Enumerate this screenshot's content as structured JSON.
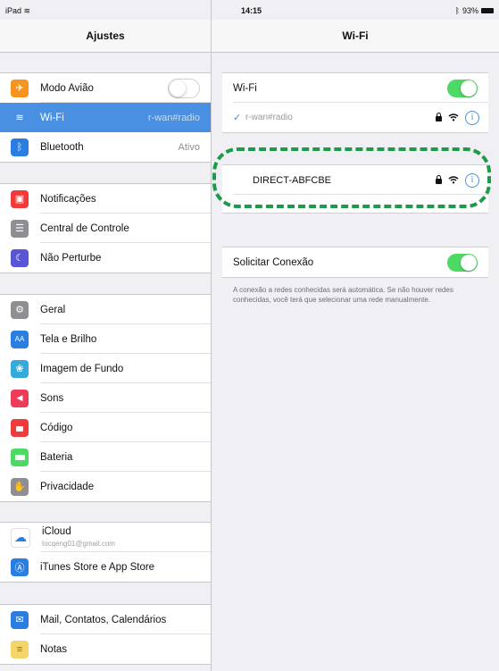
{
  "statusbar": {
    "device": "iPad",
    "time": "14:15",
    "battery": "93%"
  },
  "left": {
    "title": "Ajustes",
    "groups": [
      [
        {
          "label": "Modo Avião",
          "icon": "airplane-icon",
          "color": "#f7941d",
          "glyph": "✈"
        },
        {
          "label": "Wi-Fi",
          "icon": "wifi-icon",
          "color": "#4a90e2",
          "glyph": "≋",
          "value": "r-wan#radio"
        },
        {
          "label": "Bluetooth",
          "icon": "bluetooth-icon",
          "color": "#2a7de1",
          "glyph": "ᛒ",
          "value": "Ativo"
        }
      ],
      [
        {
          "label": "Notificações",
          "icon": "notifications-icon",
          "color": "#ef3b3b",
          "glyph": "▣"
        },
        {
          "label": "Central de Controle",
          "icon": "control-center-icon",
          "color": "#8e8e93",
          "glyph": "☰"
        },
        {
          "label": "Não Perturbe",
          "icon": "moon-icon",
          "color": "#5856d6",
          "glyph": "☾"
        }
      ],
      [
        {
          "label": "Geral",
          "icon": "gear-icon",
          "color": "#8e8e93",
          "glyph": "⚙"
        },
        {
          "label": "Tela e Brilho",
          "icon": "display-icon",
          "color": "#2a7de1",
          "glyph": "AA"
        },
        {
          "label": "Imagem de Fundo",
          "icon": "wallpaper-icon",
          "color": "#35aadc",
          "glyph": "❀"
        },
        {
          "label": "Sons",
          "icon": "sounds-icon",
          "color": "#ef3b5a",
          "glyph": "◀"
        },
        {
          "label": "Código",
          "icon": "passcode-icon",
          "color": "#ef3b3b",
          "glyph": "🔒"
        },
        {
          "label": "Bateria",
          "icon": "battery-icon",
          "color": "#4cd964",
          "glyph": "▬"
        },
        {
          "label": "Privacidade",
          "icon": "privacy-icon",
          "color": "#8e8e93",
          "glyph": "✋"
        }
      ],
      [
        {
          "label": "iCloud",
          "icon": "cloud-icon",
          "color": "#ffffff",
          "glyph": "☁",
          "sub": "tocqeng01@gmail.com"
        },
        {
          "label": "iTunes Store e App Store",
          "icon": "appstore-icon",
          "color": "#2a7de1",
          "glyph": "Ⓐ"
        }
      ],
      [
        {
          "label": "Mail, Contatos, Calendários",
          "icon": "mail-icon",
          "color": "#2a7de1",
          "glyph": "✉"
        },
        {
          "label": "Notas",
          "icon": "notes-icon",
          "color": "#f5d46a",
          "glyph": "≡"
        }
      ]
    ]
  },
  "right": {
    "title": "Wi-Fi",
    "wifi_label": "Wi-Fi",
    "connected_network": "r-wan#radio",
    "direct_network": "DIRECT-ABFCBE",
    "ask_label": "Solicitar Conexão",
    "ask_note": "A conexão a redes conhecidas será automática. Se não houver redes conhecidas, você terá que selecionar uma rede manualmente."
  }
}
